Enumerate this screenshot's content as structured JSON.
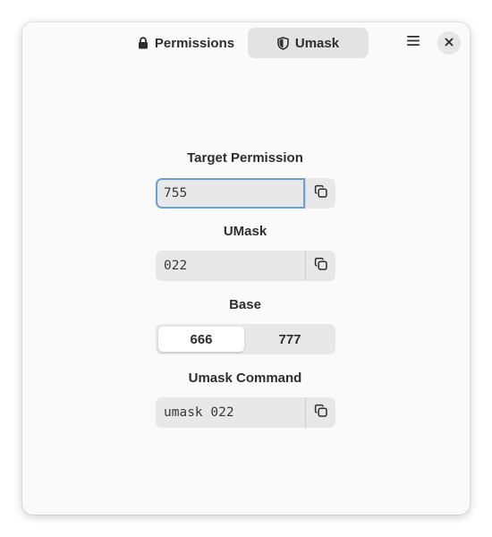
{
  "header": {
    "tabs": [
      {
        "label": "Permissions",
        "icon": "lock-icon",
        "selected": false
      },
      {
        "label": "Umask",
        "icon": "shield-icon",
        "selected": true
      }
    ],
    "menu_icon": "hamburger-menu-icon",
    "close_icon": "close-icon"
  },
  "target_permission": {
    "label": "Target Permission",
    "value": "755"
  },
  "umask": {
    "label": "UMask",
    "value": "022"
  },
  "base": {
    "label": "Base",
    "options": [
      "666",
      "777"
    ],
    "selected": "666"
  },
  "umask_command": {
    "label": "Umask Command",
    "value": "umask 022"
  },
  "colors": {
    "focus_ring": "#6e9fd6",
    "selected_tab_bg": "#e3e3e3",
    "entry_bg": "#e8e8e8",
    "window_bg": "#fafafa"
  }
}
